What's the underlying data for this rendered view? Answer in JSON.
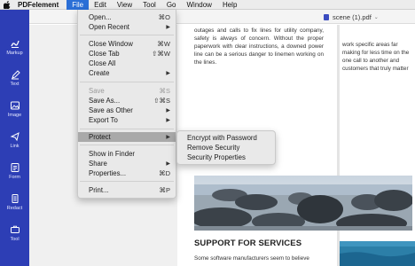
{
  "menubar": {
    "apple_icon": "apple-logo-icon",
    "items": [
      "PDFelement",
      "File",
      "Edit",
      "View",
      "Tool",
      "Go",
      "Window",
      "Help"
    ],
    "active": "File"
  },
  "sidebar": {
    "items": [
      {
        "label": "Markup",
        "icon": "markup-icon"
      },
      {
        "label": "Text",
        "icon": "text-pen-icon"
      },
      {
        "label": "Image",
        "icon": "image-icon"
      },
      {
        "label": "Link",
        "icon": "link-icon"
      },
      {
        "label": "Form",
        "icon": "form-icon"
      },
      {
        "label": "Redact",
        "icon": "redact-icon"
      },
      {
        "label": "Tool",
        "icon": "tool-icon"
      }
    ]
  },
  "document": {
    "title": "scene (1).pdf",
    "para1": "outages and calls to fix lines for utility company, safety is always of concern. Without the proper paperwork with clear instructions, a downed power line can be a serious danger to linemen working on the lines.",
    "para2": "work specific areas far making for less time on the one call to another and customers that truly matter",
    "heading": "SUPPORT FOR SERVICES",
    "para3": "Some software manufacturers seem to believe"
  },
  "file_menu": {
    "items": [
      {
        "label": "Open...",
        "shortcut": "⌘O"
      },
      {
        "label": "Open Recent",
        "shortcut": "",
        "submenu": true
      },
      {
        "separator": true
      },
      {
        "label": "Close Window",
        "shortcut": "⌘W"
      },
      {
        "label": "Close Tab",
        "shortcut": "⇧⌘W"
      },
      {
        "label": "Close All",
        "shortcut": ""
      },
      {
        "label": "Create",
        "shortcut": "",
        "submenu": true
      },
      {
        "separator": true
      },
      {
        "label": "Save",
        "shortcut": "⌘S",
        "disabled": true
      },
      {
        "label": "Save As...",
        "shortcut": "⇧⌘S"
      },
      {
        "label": "Save as Other",
        "shortcut": "",
        "submenu": true
      },
      {
        "label": "Export To",
        "shortcut": "",
        "submenu": true
      },
      {
        "separator": true
      },
      {
        "label": "Protect",
        "shortcut": "",
        "submenu": true,
        "highlighted": true
      },
      {
        "separator": true
      },
      {
        "label": "Show in Finder",
        "shortcut": ""
      },
      {
        "label": "Share",
        "shortcut": "",
        "submenu": true
      },
      {
        "label": "Properties...",
        "shortcut": "⌘D"
      },
      {
        "separator": true
      },
      {
        "label": "Print...",
        "shortcut": "⌘P"
      }
    ]
  },
  "protect_submenu": {
    "items": [
      "Encrypt with Password",
      "Remove Security",
      "Security Properties"
    ]
  },
  "colors": {
    "sidebar": "#2d3eb5",
    "menu_highlight": "#a9a9a9",
    "menubar_active": "#2b6fd6"
  }
}
